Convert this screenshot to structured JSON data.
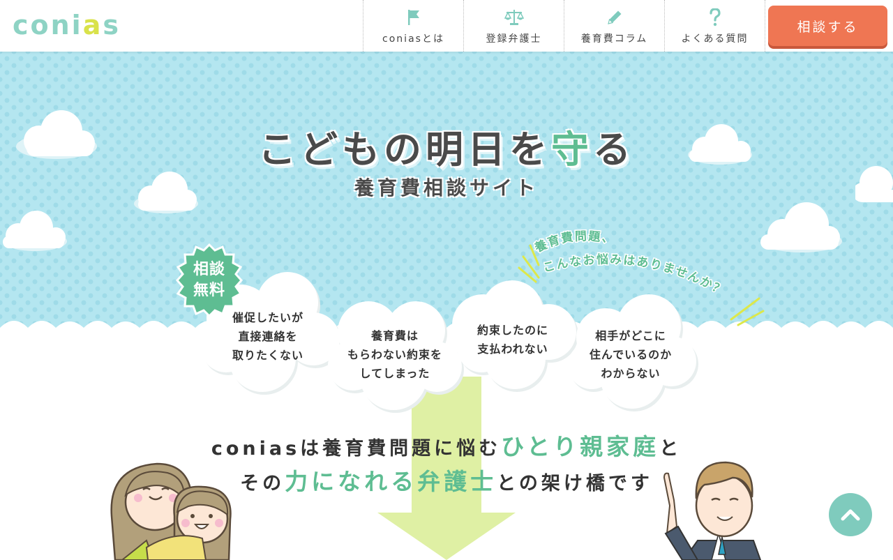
{
  "header": {
    "logo": {
      "text_main": "coni",
      "text_accent": "a",
      "text_end": "s"
    },
    "nav": [
      {
        "label": "coniasとは",
        "icon": "flag-icon"
      },
      {
        "label": "登録弁護士",
        "icon": "scale-icon"
      },
      {
        "label": "養育費コラム",
        "icon": "pencil-icon"
      },
      {
        "label": "よくある質問",
        "icon": "question-icon"
      }
    ],
    "cta_label": "相談する"
  },
  "hero": {
    "title_part1": "こどもの明日を",
    "title_highlight": "守",
    "title_part2": "る",
    "subtitle": "養育費相談サイト",
    "badge": {
      "line1": "相談",
      "line2": "無料"
    },
    "question_line1": "養育費問題、",
    "question_line2": "こんなお悩みはありませんか？",
    "bubbles": [
      {
        "lines": [
          "催促したいが",
          "直接連絡を",
          "取りたくない"
        ]
      },
      {
        "lines": [
          "養育費は",
          "もらわない約束を",
          "してしまった"
        ]
      },
      {
        "lines": [
          "約束したのに",
          "支払われない"
        ]
      },
      {
        "lines": [
          "相手がどこに",
          "住んでいるのか",
          "わからない"
        ]
      }
    ]
  },
  "intro": {
    "line1_a": "coniasは養育費問題に悩む",
    "line1_hl": "ひとり親家庭",
    "line1_b": "と",
    "line2_a": "その",
    "line2_hl": "力になれる弁護士",
    "line2_b": "との架け橋です"
  },
  "colors": {
    "accent": "#5ebd92",
    "cta": "#ef7653",
    "sky": "#b4e6f0",
    "logo": "#8ed3c4",
    "arrow": "#dff0a4"
  },
  "scroll_top_icon": "chevron-up-icon"
}
